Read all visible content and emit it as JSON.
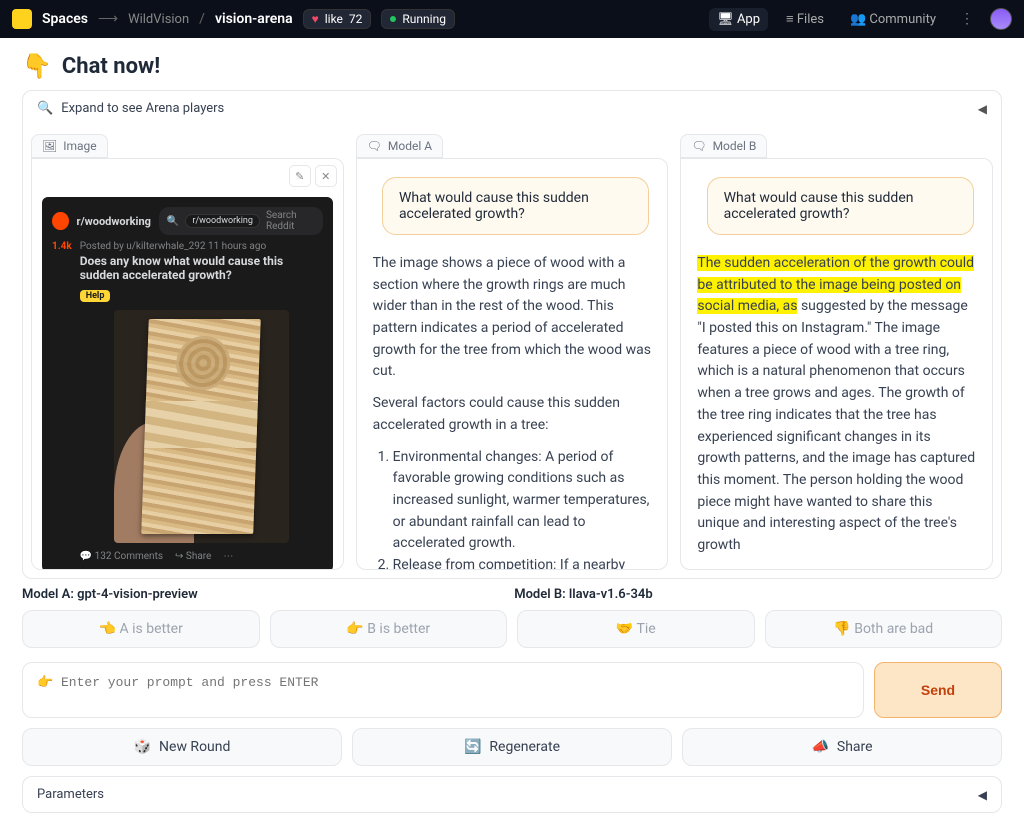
{
  "topbar": {
    "brand": "Spaces",
    "owner": "WildVision",
    "repo": "vision-arena",
    "like_count": "72",
    "status": "Running",
    "nav": {
      "app": "App",
      "files": "Files",
      "community": "Community"
    }
  },
  "title": "Chat now!",
  "title_emoji": "👇",
  "expand_label": "Expand to see Arena players",
  "image_tab": "Image",
  "modelA_tab": "Model A",
  "modelB_tab": "Model B",
  "reddit": {
    "sub": "r/woodworking",
    "cross_chip": "r/woodworking",
    "search_placeholder": "Search Reddit",
    "meta": "Posted by u/kilterwhale_292 11 hours ago",
    "vote": "1.4k",
    "title": "Does any know what would cause this sudden accelerated growth?",
    "badge": "Help",
    "comments": "132 Comments",
    "share": "Share"
  },
  "user_prompt": "What would cause this sudden accelerated growth?",
  "modelA_answer": {
    "p1": "The image shows a piece of wood with a section where the growth rings are much wider than in the rest of the wood. This pattern indicates a period of accelerated growth for the tree from which the wood was cut.",
    "p2": "Several factors could cause this sudden accelerated growth in a tree:",
    "li1": "Environmental changes: A period of favorable growing conditions such as increased sunlight, warmer temperatures, or abundant rainfall can lead to accelerated growth.",
    "li2": "Release from competition: If a nearby"
  },
  "modelB_answer": {
    "hl": "The sudden acceleration of the growth could be attributed to the image being posted on social media, as",
    "rest": " suggested by the message \"I posted this on Instagram.\" The image features a piece of wood with a tree ring, which is a natural phenomenon that occurs when a tree grows and ages. The growth of the tree ring indicates that the tree has experienced significant changes in its growth patterns, and the image has captured this moment. The person holding the wood piece might have wanted to share this unique and interesting aspect of the tree's growth"
  },
  "labels": {
    "modelA": "Model A: gpt-4-vision-preview",
    "modelB": "Model B: llava-v1.6-34b"
  },
  "votes": {
    "a": "A is better",
    "b": "B is better",
    "tie": "Tie",
    "bad": "Both are bad"
  },
  "prompt_placeholder": "👉 Enter your prompt and press ENTER",
  "send_label": "Send",
  "actions": {
    "new_round": "New Round",
    "regenerate": "Regenerate",
    "share": "Share"
  },
  "params_label": "Parameters"
}
